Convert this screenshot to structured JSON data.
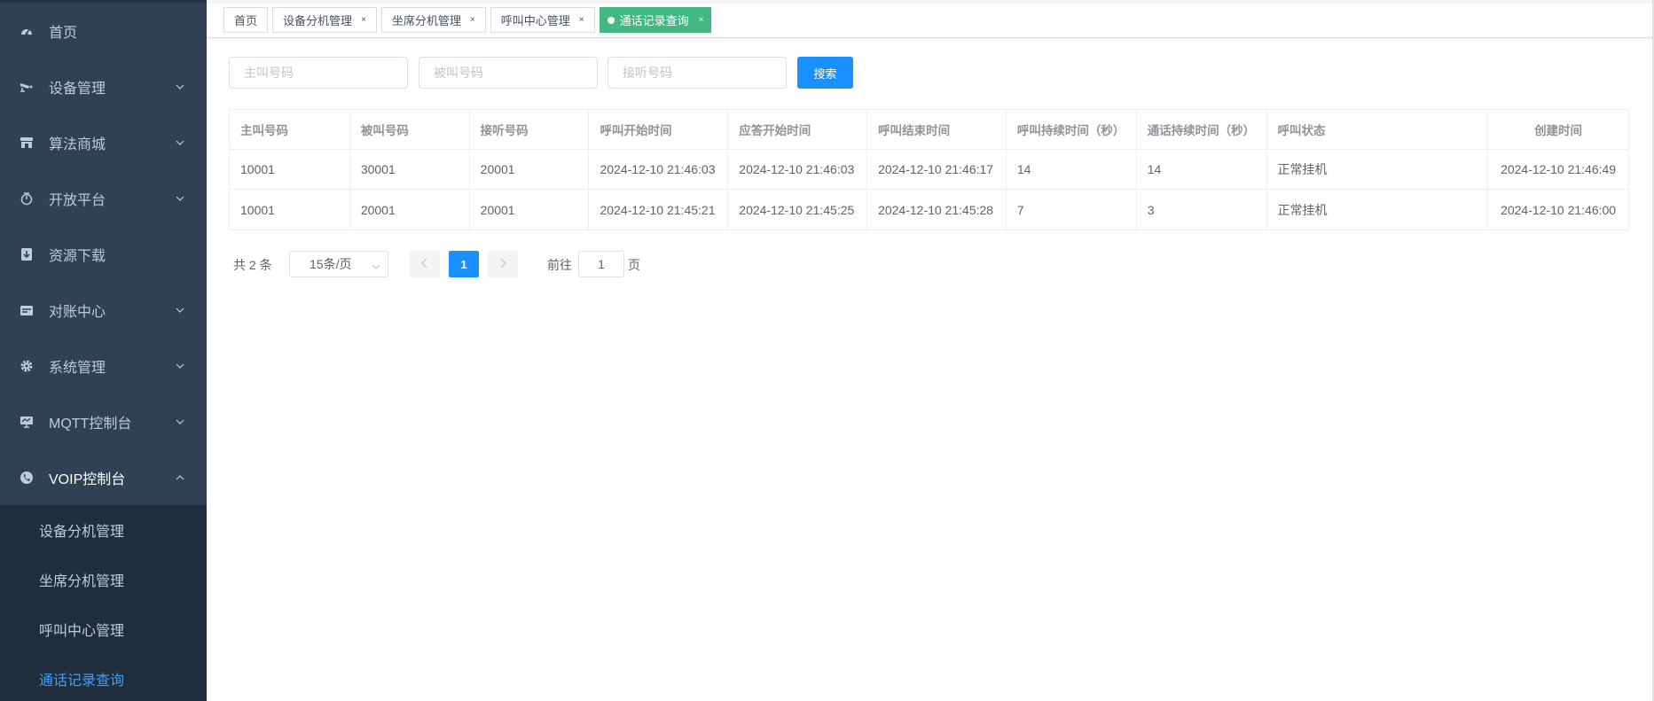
{
  "sidebar": {
    "items": [
      {
        "label": "首页",
        "icon": "dashboard-icon"
      },
      {
        "label": "设备管理",
        "icon": "camera-icon"
      },
      {
        "label": "算法商城",
        "icon": "shop-icon"
      },
      {
        "label": "开放平台",
        "icon": "open-platform-icon"
      },
      {
        "label": "资源下载",
        "icon": "download-icon"
      },
      {
        "label": "对账中心",
        "icon": "ledger-icon"
      },
      {
        "label": "系统管理",
        "icon": "gear-icon"
      },
      {
        "label": "MQTT控制台",
        "icon": "monitor-icon"
      },
      {
        "label": "VOIP控制台",
        "icon": "phone-icon"
      }
    ],
    "voip_children": [
      {
        "label": "设备分机管理"
      },
      {
        "label": "坐席分机管理"
      },
      {
        "label": "呼叫中心管理"
      },
      {
        "label": "通话记录查询"
      }
    ]
  },
  "tags": [
    {
      "label": "首页"
    },
    {
      "label": "设备分机管理",
      "close": "×"
    },
    {
      "label": "坐席分机管理",
      "close": "×"
    },
    {
      "label": "呼叫中心管理",
      "close": "×"
    },
    {
      "label": "通话记录查询",
      "close": "×"
    }
  ],
  "search": {
    "caller_placeholder": "主叫号码",
    "callee_placeholder": "被叫号码",
    "answer_placeholder": "接听号码",
    "button_label": "搜索"
  },
  "table": {
    "headers": [
      "主叫号码",
      "被叫号码",
      "接听号码",
      "呼叫开始时间",
      "应答开始时间",
      "呼叫结束时间",
      "呼叫持续时间（秒）",
      "通话持续时间（秒）",
      "呼叫状态",
      "创建时间"
    ],
    "rows": [
      [
        "10001",
        "30001",
        "20001",
        "2024-12-10 21:46:03",
        "2024-12-10 21:46:03",
        "2024-12-10 21:46:17",
        "14",
        "14",
        "正常挂机",
        "2024-12-10 21:46:49"
      ],
      [
        "10001",
        "20001",
        "20001",
        "2024-12-10 21:45:21",
        "2024-12-10 21:45:25",
        "2024-12-10 21:45:28",
        "7",
        "3",
        "正常挂机",
        "2024-12-10 21:46:00"
      ]
    ]
  },
  "pagination": {
    "total_text": "共 2 条",
    "page_size": "15条/页",
    "current_page": "1",
    "goto_label": "前往",
    "goto_value": "1",
    "page_unit": "页"
  },
  "colors": {
    "sidebar_bg": "#304156",
    "submenu_bg": "#1f2d3d",
    "active_link": "#409eff",
    "active_tag": "#42b983",
    "primary": "#1890ff"
  }
}
